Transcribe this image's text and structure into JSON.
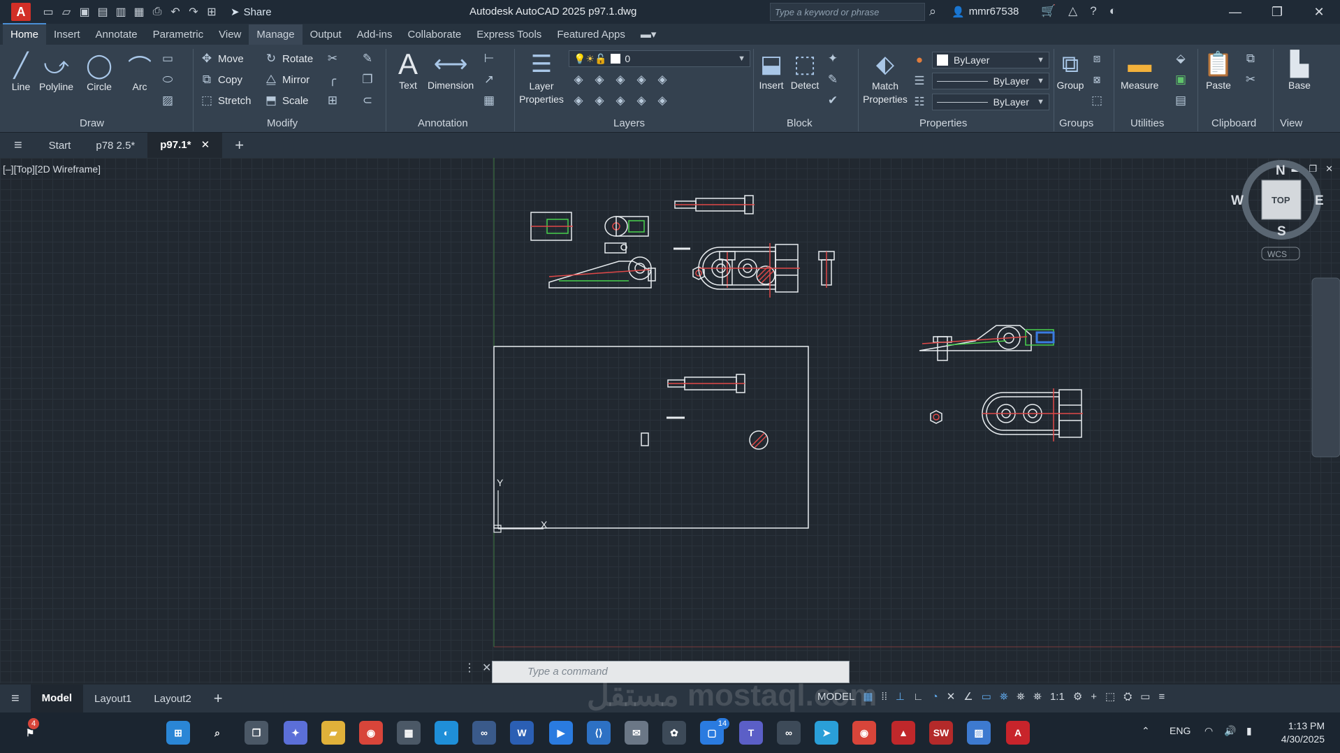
{
  "titlebar": {
    "app_icon": "A",
    "share": "Share",
    "title": "Autodesk AutoCAD 2025    p97.1.dwg",
    "search_placeholder": "Type a keyword or phrase",
    "user": "mmr67538"
  },
  "ribbon_tabs": [
    "Home",
    "Insert",
    "Annotate",
    "Parametric",
    "View",
    "Manage",
    "Output",
    "Add-ins",
    "Collaborate",
    "Express Tools",
    "Featured Apps"
  ],
  "draw": {
    "line": "Line",
    "polyline": "Polyline",
    "circle": "Circle",
    "arc": "Arc",
    "title": "Draw"
  },
  "modify": {
    "move": "Move",
    "rotate": "Rotate",
    "copy": "Copy",
    "mirror": "Mirror",
    "stretch": "Stretch",
    "scale": "Scale",
    "title": "Modify"
  },
  "annotation": {
    "text": "Text",
    "dimension": "Dimension",
    "title": "Annotation"
  },
  "layers": {
    "properties": "Layer Properties",
    "current_layer": "0",
    "title": "Layers"
  },
  "block": {
    "insert": "Insert",
    "detect": "Detect",
    "title": "Block"
  },
  "properties": {
    "match": "Match Properties",
    "color": "ByLayer",
    "linetype": "ByLayer",
    "lineweight": "ByLayer",
    "title": "Properties"
  },
  "groups": {
    "group": "Group",
    "title": "Groups"
  },
  "utilities": {
    "measure": "Measure",
    "title": "Utilities"
  },
  "clipboard": {
    "paste": "Paste",
    "title": "Clipboard"
  },
  "view": {
    "base": "Base",
    "title": "View"
  },
  "doc_tabs": {
    "start": "Start",
    "file1": "p78 2.5*",
    "file2": "p97.1*"
  },
  "viewport": {
    "label": "[–][Top][2D Wireframe]",
    "compass": {
      "n": "N",
      "s": "S",
      "e": "E",
      "w": "W",
      "top": "TOP",
      "wcs": "WCS"
    }
  },
  "command": {
    "placeholder": "Type  a  command"
  },
  "layout_tabs": {
    "model": "Model",
    "layout1": "Layout1",
    "layout2": "Layout2"
  },
  "status": {
    "model": "MODEL",
    "scale": "1:1"
  },
  "watermark": "مستقل mostaql.com",
  "taskbar": {
    "lang": "ENG",
    "time": "1:13 PM",
    "date": "4/30/2025",
    "badge": "4",
    "badge2": "14"
  }
}
